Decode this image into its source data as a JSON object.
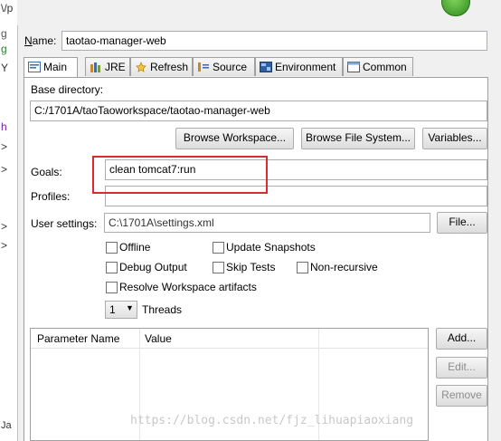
{
  "left_strip": {
    "fragments": [
      "\\/p",
      "g",
      "g",
      "Y",
      "h",
      ">",
      ">",
      ">",
      ">",
      "Ja"
    ]
  },
  "name": {
    "label": "Name:",
    "value": "taotao-manager-web"
  },
  "tabs": [
    {
      "label": "Main",
      "icon": "main-config-icon",
      "active": true
    },
    {
      "label": "JRE",
      "icon": "jre-library-icon"
    },
    {
      "label": "Refresh",
      "icon": "refresh-icon"
    },
    {
      "label": "Source",
      "icon": "source-lookup-icon"
    },
    {
      "label": "Environment",
      "icon": "environment-icon"
    },
    {
      "label": "Common",
      "icon": "common-tab-icon"
    }
  ],
  "base_directory": {
    "label": "Base directory:",
    "value": "C:/1701A/taoTaoworkspace/taotao-manager-web"
  },
  "buttons": {
    "browse_workspace": "Browse Workspace...",
    "browse_file_system": "Browse File System...",
    "variables": "Variables...",
    "file": "File...",
    "add": "Add...",
    "edit": "Edit...",
    "remove": "Remove"
  },
  "goals": {
    "label": "Goals:",
    "value": "clean tomcat7:run"
  },
  "profiles": {
    "label": "Profiles:",
    "value": ""
  },
  "user_settings": {
    "label": "User settings:",
    "value": "C:\\1701A\\settings.xml"
  },
  "options": {
    "offline": {
      "label": "Offline",
      "checked": false
    },
    "update_snapshots": {
      "label": "Update Snapshots",
      "checked": false
    },
    "debug_output": {
      "label": "Debug Output",
      "checked": false
    },
    "skip_tests": {
      "label": "Skip Tests",
      "checked": false
    },
    "non_recursive": {
      "label": "Non-recursive",
      "checked": false
    },
    "resolve_workspace": {
      "label": "Resolve Workspace artifacts",
      "checked": false
    }
  },
  "threads": {
    "value": "1",
    "label": "Threads"
  },
  "table": {
    "columns": [
      "Parameter Name",
      "Value"
    ],
    "rows": []
  },
  "watermark": "https://blog.csdn.net/fjz_lihuapiaoxiang",
  "colors": {
    "highlight_box": "#e0282e",
    "accent_green": "#3c9a2a"
  }
}
